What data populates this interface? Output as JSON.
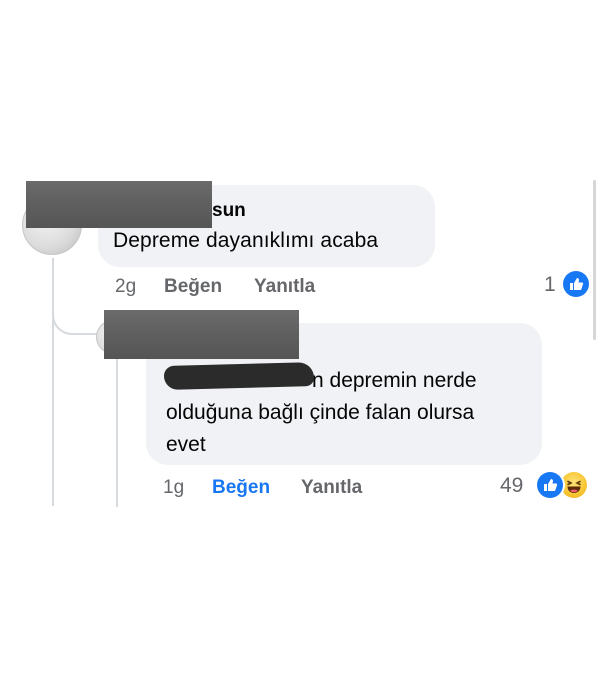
{
  "colors": {
    "bubble": "#f0f2f5",
    "text": "#050505",
    "meta": "#65676b",
    "accent": "#1877f2",
    "redaction": "#5f5f5f"
  },
  "comment": {
    "author_visible": "sun",
    "text": "Depreme dayanıklımı acaba",
    "time": "2g",
    "like_label": "Beğen",
    "reply_label": "Yanıtla",
    "reaction_count": "1",
    "reaction_icons": [
      "like-icon"
    ]
  },
  "reply": {
    "line1": "n depremin nerde",
    "line2": "olduğuna bağlı çinde falan olursa",
    "line3": "evet",
    "time": "1g",
    "like_label": "Beğen",
    "like_active": true,
    "reply_label": "Yanıtla",
    "reaction_count": "49",
    "reaction_icons": [
      "like-icon",
      "haha-icon"
    ]
  }
}
